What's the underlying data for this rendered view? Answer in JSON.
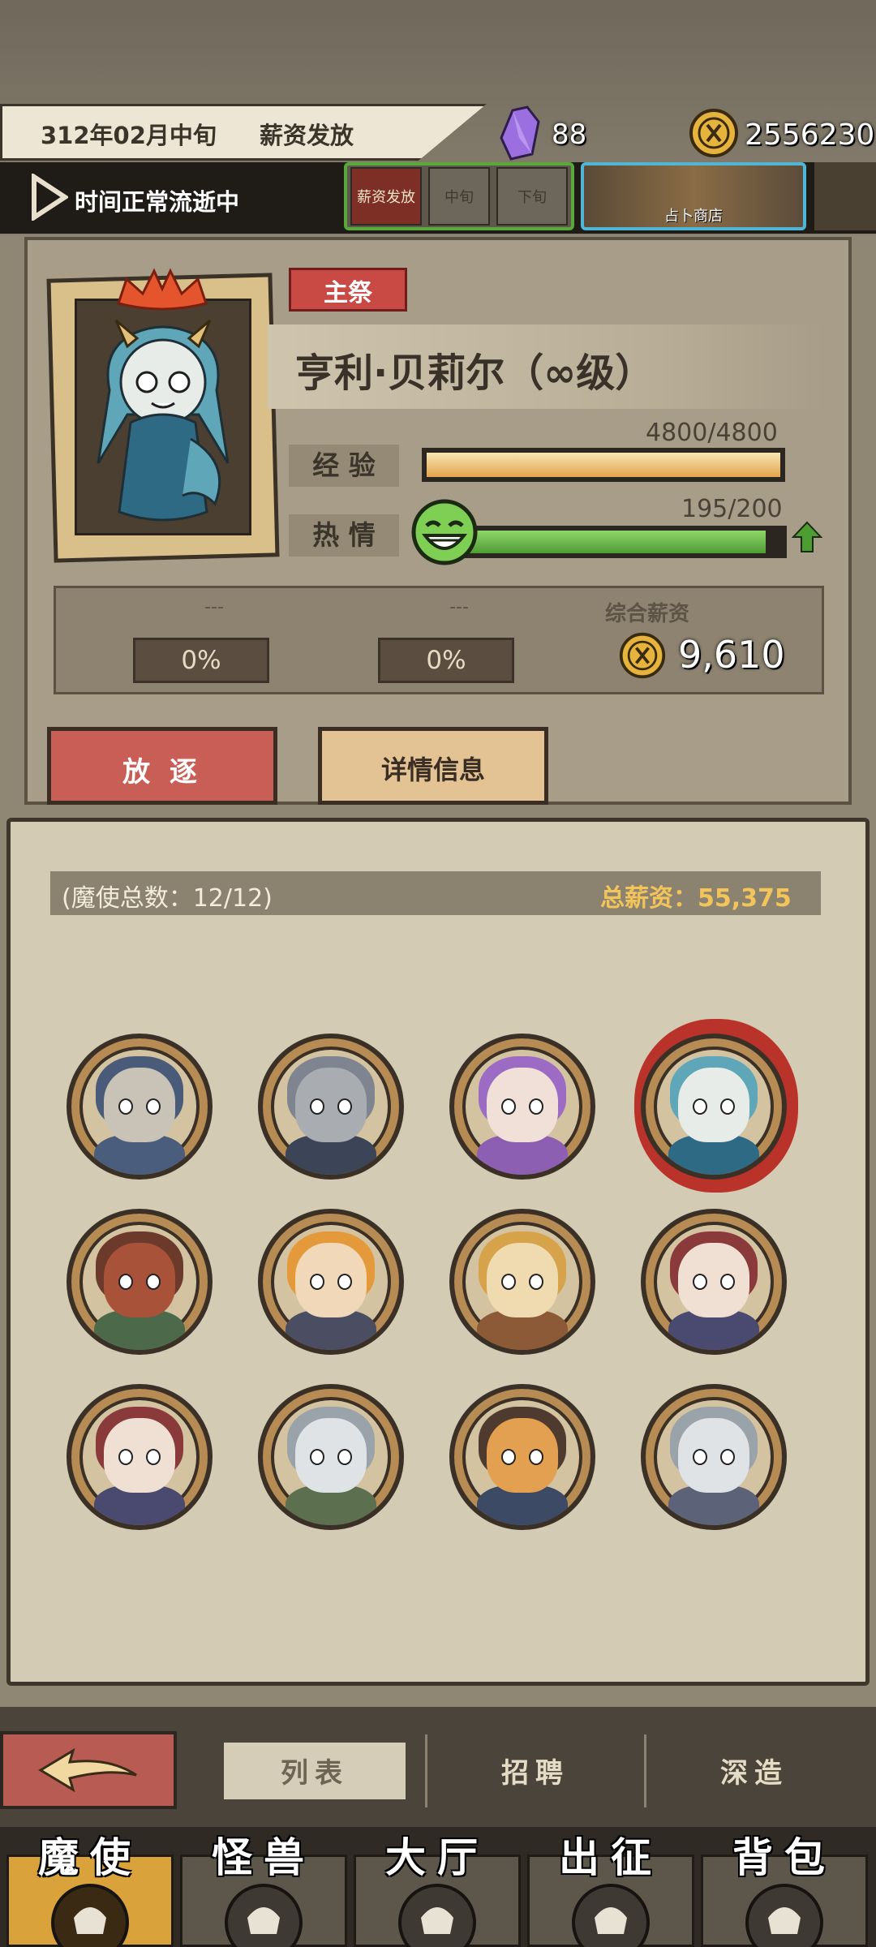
{
  "top_bar": {
    "date": "312年02月中旬",
    "event": "薪资发放",
    "crystal_count": "88",
    "gold_count": "2556230",
    "time_status": "时间正常流逝中",
    "phases": [
      "薪资发放",
      "中旬",
      "下旬"
    ],
    "shop_label": "占卜商店"
  },
  "character": {
    "role_badge": "主祭",
    "name": "亨利·贝莉尔（∞级）",
    "exp_label": "经 验",
    "exp_value": "4800/4800",
    "exp_fraction": 1.0,
    "passion_label": "热 情",
    "passion_value": "195/200",
    "passion_fraction": 0.975,
    "slots": [
      {
        "dash": "---",
        "percent": "0%"
      },
      {
        "dash": "---",
        "percent": "0%"
      }
    ],
    "salary_title": "综合薪资",
    "salary_value": "9,610",
    "exile_button": "放 逐",
    "details_button": "详情信息"
  },
  "roster": {
    "count_text": "(魔使总数：12/12)",
    "total_salary_text": "总薪资：55,375",
    "avatars": [
      {
        "name": "avatar-hooded-knight",
        "hair": "#4a5b7a",
        "skin": "#c9c2b6",
        "cloth": "#4b5d7c"
      },
      {
        "name": "avatar-horned-mask",
        "hair": "#7f8590",
        "skin": "#a9acb0",
        "cloth": "#3c4558"
      },
      {
        "name": "avatar-purple-hair-girl",
        "hair": "#9c6cc4",
        "skin": "#f0e0d8",
        "cloth": "#8c5fb2"
      },
      {
        "name": "avatar-horned-succubus-selected",
        "hair": "#5ea6b8",
        "skin": "#e8ece8",
        "cloth": "#2f6a85"
      },
      {
        "name": "avatar-masked-hunter",
        "hair": "#6b3a2a",
        "skin": "#a9523a",
        "cloth": "#4c6a4a"
      },
      {
        "name": "avatar-pumpkin-girl",
        "hair": "#e49a3a",
        "skin": "#f1d8b8",
        "cloth": "#4b4e63"
      },
      {
        "name": "avatar-witch-hat-girl",
        "hair": "#d7a34a",
        "skin": "#f0dbb0",
        "cloth": "#8c5a36"
      },
      {
        "name": "avatar-purple-hat-a",
        "hair": "#8a3a3a",
        "skin": "#f0e0d4",
        "cloth": "#4a4a70"
      },
      {
        "name": "avatar-purple-hat-b",
        "hair": "#8a3a3a",
        "skin": "#f0e0d4",
        "cloth": "#4a4a70"
      },
      {
        "name": "avatar-gray-haired-a",
        "hair": "#9aa2aa",
        "skin": "#dfe3e6",
        "cloth": "#5c7050"
      },
      {
        "name": "avatar-spiky-beast",
        "hair": "#4e3a2e",
        "skin": "#e2a050",
        "cloth": "#3c4a66"
      },
      {
        "name": "avatar-gray-haired-b",
        "hair": "#9aa2aa",
        "skin": "#dfe3e6",
        "cloth": "#5c6378"
      }
    ]
  },
  "sub_tabs": {
    "list": "列表",
    "recruit": "招聘",
    "deep": "深造"
  },
  "main_nav": [
    "魔使",
    "怪兽",
    "大厅",
    "出征",
    "背包"
  ],
  "colors": {
    "accent_red": "#c95e56",
    "gold_text": "#f2c45a",
    "passion_green": "#4e9d33",
    "shop_border": "#4fb6d6",
    "phase_border": "#58a83a"
  }
}
